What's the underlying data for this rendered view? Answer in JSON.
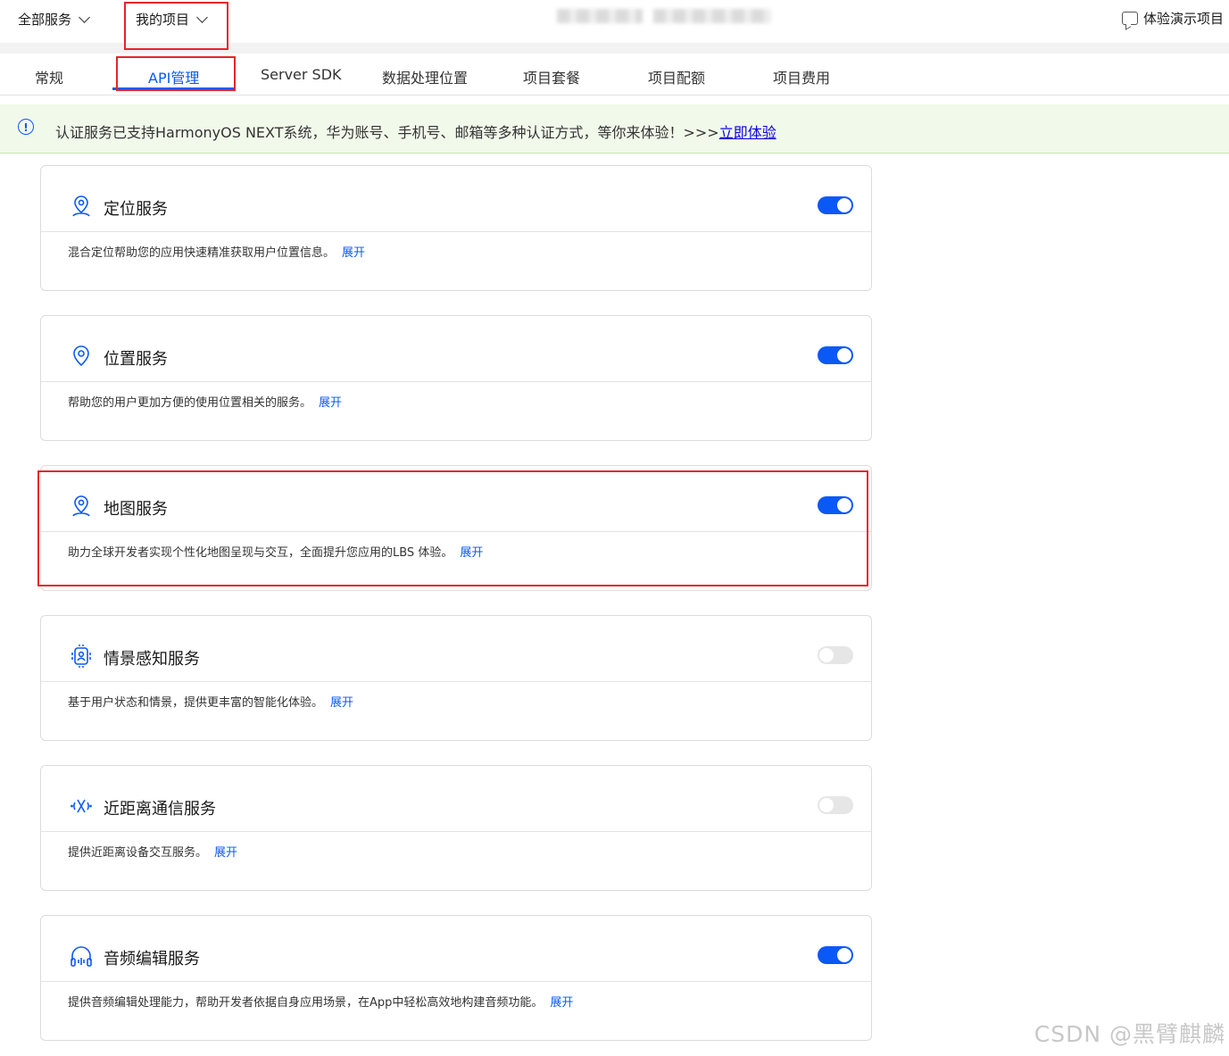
{
  "topnav": {
    "all_services": "全部服务",
    "my_projects": "我的项目",
    "demo_project": "体验演示项目"
  },
  "tabs": [
    {
      "label": "常规",
      "active": false
    },
    {
      "label": "API管理",
      "active": true
    },
    {
      "label": "Server SDK",
      "active": false
    },
    {
      "label": "数据处理位置",
      "active": false
    },
    {
      "label": "项目套餐",
      "active": false
    },
    {
      "label": "项目配额",
      "active": false
    },
    {
      "label": "项目费用",
      "active": false
    }
  ],
  "banner": {
    "text": "认证服务已支持HarmonyOS NEXT系统，华为账号、手机号、邮箱等多种认证方式，等你来体验！>>>",
    "link": "立即体验"
  },
  "services": [
    {
      "title": "定位服务",
      "desc": "混合定位帮助您的应用快速精准获取用户位置信息。",
      "expand": "展开",
      "enabled": true,
      "icon": "location-person-icon"
    },
    {
      "title": "位置服务",
      "desc": "帮助您的用户更加方便的使用位置相关的服务。",
      "expand": "展开",
      "enabled": true,
      "icon": "location-pin-icon"
    },
    {
      "title": "地图服务",
      "desc": "助力全球开发者实现个性化地图呈现与交互，全面提升您应用的LBS 体验。",
      "expand": "展开",
      "enabled": true,
      "icon": "map-person-icon"
    },
    {
      "title": "情景感知服务",
      "desc": "基于用户状态和情景，提供更丰富的智能化体验。",
      "expand": "展开",
      "enabled": false,
      "icon": "context-awareness-icon"
    },
    {
      "title": "近距离通信服务",
      "desc": "提供近距离设备交互服务。",
      "expand": "展开",
      "enabled": false,
      "icon": "nearby-signal-icon"
    },
    {
      "title": "音频编辑服务",
      "desc": "提供音频编辑处理能力，帮助开发者依据自身应用场景，在App中轻松高效地构建音频功能。",
      "expand": "展开",
      "enabled": true,
      "icon": "headphones-icon"
    }
  ],
  "colors": {
    "accent": "#0a59f7",
    "highlight": "#e8232a",
    "banner_bg": "#f1f9ea"
  },
  "watermark": "CSDN @黑臂麒麟"
}
